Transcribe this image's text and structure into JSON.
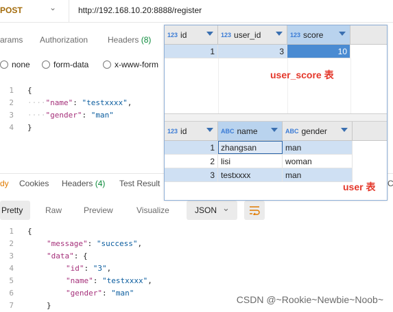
{
  "request": {
    "method": "POST",
    "url": "http://192.168.10.20:8888/register",
    "tabs": [
      {
        "label": "arams"
      },
      {
        "label": "Authorization"
      },
      {
        "label": "Headers",
        "count": "(8)"
      }
    ],
    "body_types": [
      "none",
      "form-data",
      "x-www-form"
    ],
    "body_lines": [
      "1",
      "2",
      "3",
      "4"
    ],
    "body": {
      "line1": "{",
      "name_key": "\"name\"",
      "name_val": "\"testxxxx\"",
      "gender_key": "\"gender\"",
      "gender_val": "\"man\"",
      "line4": "}"
    }
  },
  "response": {
    "tabs": [
      {
        "label": "dy"
      },
      {
        "label": "Cookies"
      },
      {
        "label": "Headers",
        "count": "(4)"
      },
      {
        "label": "Test Result"
      }
    ],
    "tab_tail": "C",
    "formats": [
      "Pretty",
      "Raw",
      "Preview",
      "Visualize"
    ],
    "language": "JSON",
    "line_numbers": [
      "1",
      "2",
      "3",
      "4",
      "5",
      "6",
      "7"
    ],
    "body": {
      "open": "{",
      "message_key": "\"message\"",
      "message_val": "\"success\"",
      "data_key": "\"data\"",
      "id_key": "\"id\"",
      "id_val": "\"3\"",
      "name_key": "\"name\"",
      "name_val": "\"testxxxx\"",
      "gender_key": "\"gender\"",
      "gender_val": "\"man\"",
      "close_inner": "}"
    }
  },
  "db": {
    "user_score": {
      "caption": "user_score 表",
      "columns": [
        {
          "type": "123",
          "name": "id"
        },
        {
          "type": "123",
          "name": "user_id"
        },
        {
          "type": "123",
          "name": "score"
        }
      ],
      "rows": [
        [
          "1",
          "3",
          "10"
        ]
      ]
    },
    "user": {
      "caption": "user 表",
      "columns": [
        {
          "type": "123",
          "name": "id"
        },
        {
          "type": "ABC",
          "name": "name"
        },
        {
          "type": "ABC",
          "name": "gender"
        }
      ],
      "rows": [
        [
          "1",
          "zhangsan",
          "man"
        ],
        [
          "2",
          "lisi",
          "woman"
        ],
        [
          "3",
          "testxxxx",
          "man"
        ]
      ]
    }
  },
  "watermark": "CSDN @~Rookie~Newbie~Noob~",
  "colors": {
    "caption": "#e4372a",
    "selection": "#4a8bd2",
    "row_highlight": "#cfe0f3"
  }
}
